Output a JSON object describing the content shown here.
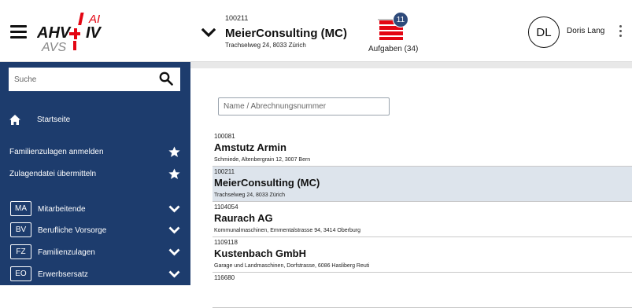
{
  "header": {
    "logo": {
      "top_left": "AHV",
      "top_right": "AI",
      "right": "IV",
      "bottom": "AVS",
      "cross_color": "#e30613",
      "text_color": "#111111"
    },
    "client": {
      "number": "100211",
      "name": "MeierConsulting (MC)",
      "address": "Trachselweg 24, 8033 Zürich"
    },
    "tasks": {
      "badge_count": "11",
      "label": "Aufgaben (34)",
      "icon": "stacked-tasks-icon"
    },
    "user": {
      "initials": "DL",
      "name": "Doris Lang"
    }
  },
  "sidebar": {
    "search_placeholder": "Suche",
    "home_label": "Startseite",
    "favorites": [
      {
        "label": "Familienzulagen anmelden"
      },
      {
        "label": "Zulagendatei übermitteln"
      }
    ],
    "groups": [
      {
        "abbrev": "MA",
        "label": "Mitarbeitende"
      },
      {
        "abbrev": "BV",
        "label": "Berufliche Vorsorge"
      },
      {
        "abbrev": "FZ",
        "label": "Familienzulagen"
      },
      {
        "abbrev": "EO",
        "label": "Erwerbsersatz"
      }
    ]
  },
  "main": {
    "filter_placeholder": "Name / Abrechnungsnummer",
    "clients": [
      {
        "number": "100081",
        "name": "Amstutz Armin",
        "address": "Schmiede, Altenbergrain 12, 3007 Bern",
        "selected": false
      },
      {
        "number": "100211",
        "name": "MeierConsulting (MC)",
        "address": "Trachselweg 24, 8033 Zürich",
        "selected": true
      },
      {
        "number": "1104054",
        "name": "Raurach AG",
        "address": "Kommunalmaschinen, Emmentalstrasse 94, 3414 Oberburg",
        "selected": false
      },
      {
        "number": "1109118",
        "name": "Kustenbach GmbH",
        "address": "Garage und Landmaschinen, Dorfstrasse, 6086 Hasliberg Reuti",
        "selected": false
      },
      {
        "number": "116680",
        "name": "",
        "address": "",
        "selected": false
      }
    ]
  },
  "colors": {
    "sidebar_bg": "#1d3c6d",
    "selected_row_bg": "#dde4ec",
    "badge_bg": "#2e4a7a",
    "brand_red": "#e30613"
  }
}
